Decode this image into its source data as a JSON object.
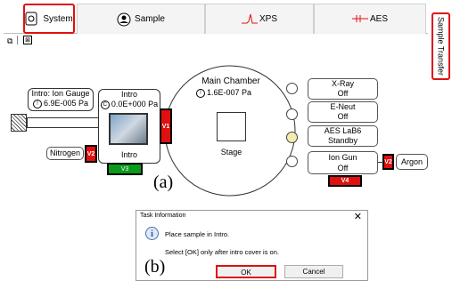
{
  "tabs": [
    {
      "label": "System",
      "icon": "system-icon"
    },
    {
      "label": "Sample",
      "icon": "sample-icon"
    },
    {
      "label": "XPS",
      "icon": "xps-icon"
    },
    {
      "label": "AES",
      "icon": "aes-icon"
    }
  ],
  "side_tab": "Sample Transfer",
  "intro_gauge": {
    "title": "Intro: Ion Gauge",
    "value": "6.9E-005 Pa"
  },
  "intro": {
    "title": "Intro",
    "value": "0.0E+000 Pa",
    "footer": "Intro"
  },
  "main_chamber": {
    "title": "Main Chamber",
    "value": "1.6E-007 Pa",
    "stage": "Stage"
  },
  "sources": [
    {
      "name": "X-Ray",
      "state": "Off"
    },
    {
      "name": "E-Neut",
      "state": "Off"
    },
    {
      "name": "AES LaB6",
      "state": "Standby"
    },
    {
      "name": "Ion Gun",
      "state": "Off"
    }
  ],
  "valves": {
    "v1": "V1",
    "v2_left": "V2",
    "v2_right": "V2",
    "v3": "V3",
    "v4": "V4"
  },
  "gases": {
    "nitrogen": "Nitrogen",
    "argon": "Argon"
  },
  "fig_label_a": "(a)",
  "fig_label_b": "(b)",
  "dialog": {
    "title": "Task Information",
    "message": "Place sample in Intro.",
    "note": "Select [OK] only after intro cover is on.",
    "ok": "OK",
    "cancel": "Cancel"
  },
  "colors": {
    "alert": "#e01010",
    "valve_open": "#0a9a1a"
  }
}
